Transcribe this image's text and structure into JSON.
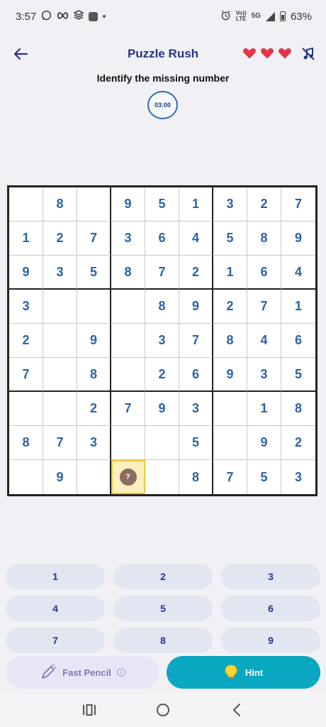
{
  "status_bar": {
    "time": "3:57",
    "battery": "63%",
    "network": "5G",
    "volte_line1": "Vo))",
    "volte_line2": "LTE",
    "whatsapp_icon": "whatsapp-icon",
    "infinity_icon": "infinity-icon",
    "alarm_icon": "alarm-icon"
  },
  "header": {
    "title": "Puzzle Rush",
    "lives": 3,
    "heart_color": "#e53447"
  },
  "instruction": "Identify the missing number",
  "timer": "03:00",
  "board": {
    "rows": [
      [
        "",
        "8",
        "",
        "9",
        "5",
        "1",
        "3",
        "2",
        "7"
      ],
      [
        "1",
        "2",
        "7",
        "3",
        "6",
        "4",
        "5",
        "8",
        "9"
      ],
      [
        "9",
        "3",
        "5",
        "8",
        "7",
        "2",
        "1",
        "6",
        "4"
      ],
      [
        "3",
        "",
        "",
        "",
        "8",
        "9",
        "2",
        "7",
        "1"
      ],
      [
        "2",
        "",
        "9",
        "",
        "3",
        "7",
        "8",
        "4",
        "6"
      ],
      [
        "7",
        "",
        "8",
        "",
        "2",
        "6",
        "9",
        "3",
        "5"
      ],
      [
        "",
        "",
        "2",
        "7",
        "9",
        "3",
        "",
        "1",
        "8"
      ],
      [
        "8",
        "7",
        "3",
        "",
        "",
        "5",
        "",
        "9",
        "2"
      ],
      [
        "",
        "9",
        "",
        "?",
        "",
        "8",
        "7",
        "5",
        "3"
      ]
    ],
    "selected_cell": {
      "row": 8,
      "col": 3
    },
    "selected_marker": "?",
    "digit_color": "#2a63a8",
    "highlight_color": "#fbf0bd"
  },
  "keypad": [
    "1",
    "2",
    "3",
    "4",
    "5",
    "6",
    "7",
    "8",
    "9"
  ],
  "actions": {
    "fast_pencil_label": "Fast Pencil",
    "info_glyph": "i",
    "hint_label": "Hint",
    "hint_color": "#0aa7c0"
  }
}
